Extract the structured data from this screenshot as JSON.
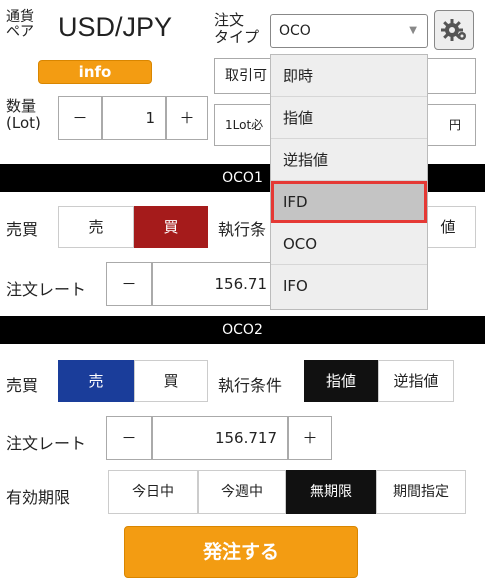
{
  "header": {
    "pair_label": "通貨\nペア",
    "pair_value": "USD/JPY",
    "info_label": "info",
    "order_type_label": "注文\nタイプ",
    "order_type_value": "OCO",
    "gear_icon": "gear-icon"
  },
  "quantity": {
    "label": "数量\n(Lot)",
    "minus": "－",
    "value": "1",
    "plus": "＋",
    "note_left_1": "取引可",
    "note_left_2": "1Lot必",
    "note_right_2": "円"
  },
  "oco1": {
    "title": "OCO1",
    "side_label": "売買",
    "sell": "売",
    "buy": "買",
    "exec_label": "執行条",
    "exec_right": "値",
    "rate_label": "注文レート",
    "rate_minus": "－",
    "rate_value": "156.71"
  },
  "oco2": {
    "title": "OCO2",
    "side_label": "売買",
    "sell": "売",
    "buy": "買",
    "exec_label": "執行条件",
    "exec_limit": "指値",
    "exec_stop": "逆指値",
    "rate_label": "注文レート",
    "rate_minus": "－",
    "rate_value": "156.717",
    "rate_plus": "＋"
  },
  "expiry": {
    "label": "有効期限",
    "options": [
      "今日中",
      "今週中",
      "無期限",
      "期間指定"
    ]
  },
  "dropdown": {
    "options": [
      "即時",
      "指値",
      "逆指値",
      "IFD",
      "OCO",
      "IFO"
    ],
    "highlighted": "IFD"
  },
  "submit_label": "発注する",
  "colors": {
    "accent_orange": "#f39c12",
    "buy_red": "#a51b1b",
    "sell_blue": "#1a3d9a",
    "highlight_red": "#e53935"
  }
}
